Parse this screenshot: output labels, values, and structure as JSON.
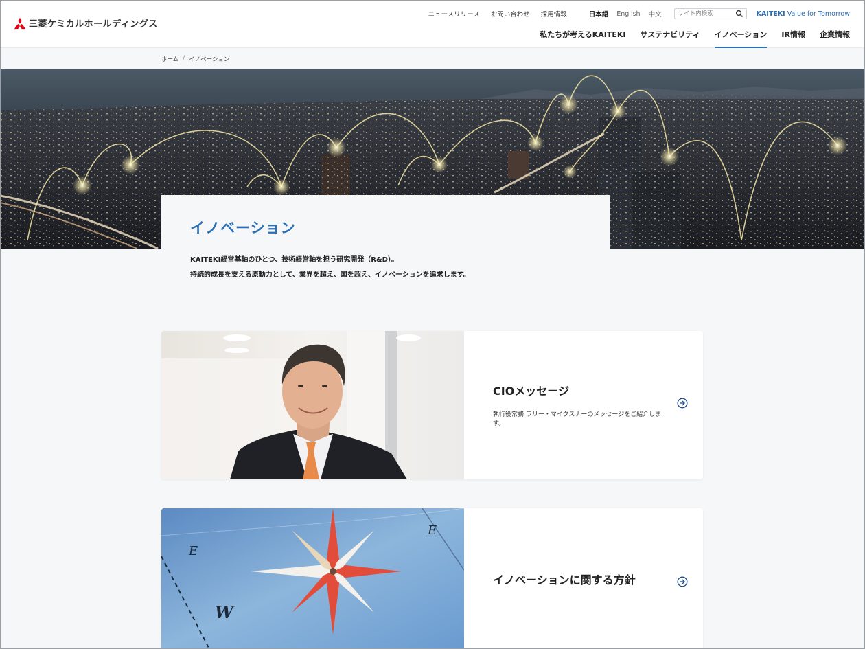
{
  "header": {
    "logo_text": "三菱ケミカルホールディングス",
    "util_links": [
      "ニュースリリース",
      "お問い合わせ",
      "採用情報"
    ],
    "languages": [
      "日本語",
      "English",
      "中文"
    ],
    "search_placeholder": "サイト内検索",
    "tagline_brand": "KAITEKI",
    "tagline_rest": " Value for Tomorrow",
    "nav": [
      "私たちが考えるKAITEKI",
      "サステナビリティ",
      "イノベーション",
      "IR情報",
      "企業情報"
    ]
  },
  "breadcrumb": {
    "home": "ホーム",
    "current": "イノベーション"
  },
  "hero": {
    "title": "イノベーション",
    "lead_line1": "KAITEKI経営基軸のひとつ、技術経営軸を担う研究開発（R&D）。",
    "lead_line2": "持続的成長を支える原動力として、業界を超え、国を超え、イノベーションを追求します。"
  },
  "cards": [
    {
      "title": "CIOメッセージ",
      "desc": "執行役常務 ラリー・マイクスナーのメッセージをご紹介します。"
    },
    {
      "title": "イノベーションに関する方針",
      "desc": ""
    }
  ],
  "compass_letters": [
    "E",
    "W"
  ],
  "colors": {
    "accent": "#2b6fb5",
    "brand_red": "#e60012"
  }
}
